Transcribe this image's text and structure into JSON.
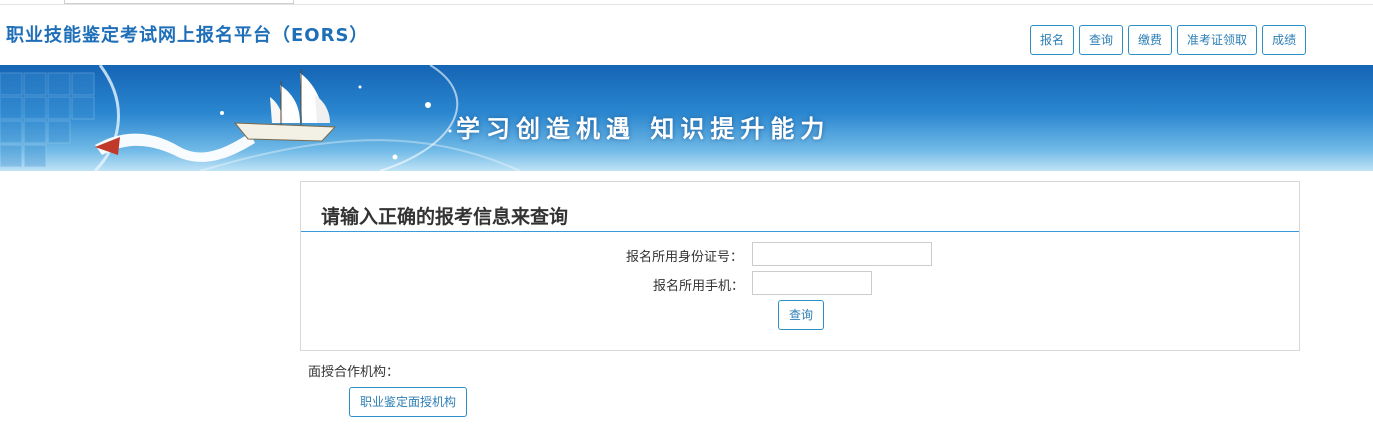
{
  "header": {
    "site_title": "职业技能鉴定考试网上报名平台（EORS）",
    "nav": [
      {
        "label": "报名"
      },
      {
        "label": "查询"
      },
      {
        "label": "缴费"
      },
      {
        "label": "准考证领取"
      },
      {
        "label": "成绩"
      }
    ]
  },
  "banner": {
    "slogan": "学习创造机遇  知识提升能力"
  },
  "query_form": {
    "title": "请输入正确的报考信息来查询",
    "id_label": "报名所用身份证号：",
    "id_value": "",
    "phone_label": "报名所用手机：",
    "phone_value": "",
    "submit_label": "查询"
  },
  "partners": {
    "label": "面授合作机构：",
    "button_label": "职业鉴定面授机构"
  },
  "colors": {
    "accent": "#2d8fc5",
    "title_blue": "#1f6fb8",
    "banner_top": "#1565b5",
    "banner_bottom": "#bfe3f6"
  }
}
